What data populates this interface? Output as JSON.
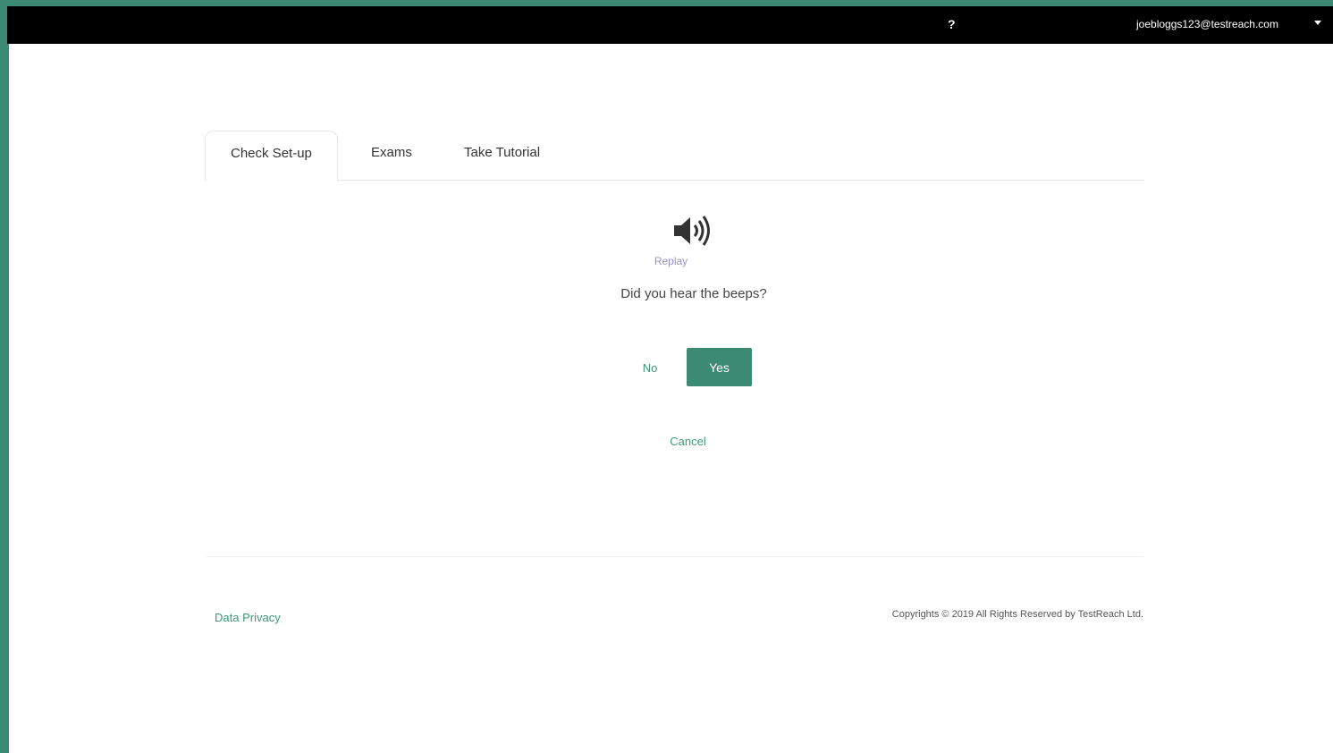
{
  "topbar": {
    "help_label": "?",
    "user_email": "joebloggs123@testreach.com"
  },
  "tabs": [
    {
      "label": "Check Set-up",
      "active": true
    },
    {
      "label": "Exams",
      "active": false
    },
    {
      "label": "Take Tutorial",
      "active": false
    }
  ],
  "audio_check": {
    "icon": "speaker-icon",
    "replay_label": "Replay",
    "question": "Did you hear the beeps?",
    "no_label": "No",
    "yes_label": "Yes",
    "cancel_label": "Cancel"
  },
  "footer": {
    "privacy_label": "Data Privacy",
    "copyright": "Copyrights © 2019 All Rights Reserved by TestReach Ltd."
  },
  "colors": {
    "frame": "#3d8a72",
    "accent": "#3d9a76",
    "topbar": "#000000",
    "replay": "#9a93c9"
  }
}
